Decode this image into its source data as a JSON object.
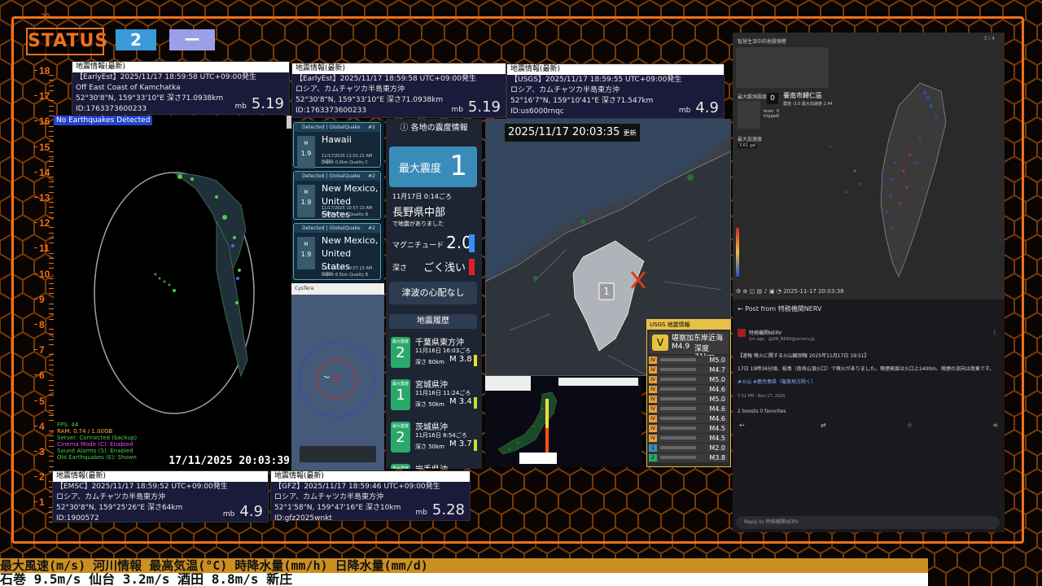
{
  "status": {
    "label": "STATUS",
    "level_a": "2",
    "level_b": "ー",
    "top_tick": "20"
  },
  "ruler_ticks": [
    "18",
    "17",
    "16",
    "15",
    "14",
    "13",
    "12",
    "11",
    "10",
    "9",
    "8",
    "7",
    "6",
    "5",
    "4",
    "3",
    "2",
    "1"
  ],
  "quakes": {
    "earlyest_1": {
      "header": "地震情報(最新)",
      "line1": "【EarlyEst】2025/11/17  18:59:58  UTC+09:00発生",
      "line2": "Off East Coast of Kamchatka",
      "line3": "52°30'8\"N, 159°33'10\"E  深さ71.0938km",
      "line4": "ID:1763373600233",
      "unit": "mb",
      "mag": "5.19"
    },
    "earlyest_2": {
      "header": "地震情報(最新)",
      "line1": "【EarlyEst】2025/11/17  18:59:58  UTC+09:00発生",
      "line2": "ロシア、カムチャツカ半島東方沖",
      "line3": "52°30'8\"N, 159°33'10\"E  深さ71.0938km",
      "line4": "ID:1763373600233",
      "unit": "mb",
      "mag": "5.19"
    },
    "usgs": {
      "header": "地震情報(最新)",
      "line1": "【USGS】2025/11/17  18:59:55  UTC+09:00発生",
      "line2": "ロシア、カムチャツカ半島東方沖",
      "line3": "52°16'7\"N, 159°10'41\"E  深さ71.547km",
      "line4": "ID:us6000rnqc",
      "unit": "mb",
      "mag": "4.9"
    },
    "emsc": {
      "header": "地震情報(最新)",
      "line1": "【EMSC】2025/11/17  18:59:52  UTC+09:00発生",
      "line2": "ロシア、カムチャツカ半島東方沖",
      "line3": "52°30'8\"N, 159°25'26\"E  深さ64km",
      "line4": "ID:1900572",
      "unit": "mb",
      "mag": "4.9"
    },
    "gfz": {
      "header": "地震情報(最新)",
      "line1": "【GFZ】2025/11/17  18:59:46  UTC+09:00発生",
      "line2": "ロシア、カムチャツカ半島東方沖",
      "line3": "52°1'58\"N, 159°47'16\"E  深さ10km",
      "line4": "ID:gfz2025wnkt",
      "unit": "mb",
      "mag": "5.28"
    }
  },
  "globe": {
    "banner": "No Earthquakes Detected",
    "sys": [
      "FPS: 44",
      "RAM: 0.74 / 1.00GB",
      "Server: Connected (backup)",
      "Cinema Mode (C): Enabled",
      "Sound Alarms (S): Enabled",
      "Old Earthquakes (E): Shown"
    ],
    "clock": "17/11/2025 20:03:39"
  },
  "gq": {
    "cards": [
      {
        "header": "Detected | GlobalQuake",
        "num": "#2",
        "m_label": "M",
        "m_val": "1.9",
        "title": "Hawaii",
        "sub1": "11/17/2025 11:01:21 AM (UTC)",
        "sub2": "Depth 0.0km    Quality C"
      },
      {
        "header": "Detected | GlobalQuake",
        "num": "#2",
        "m_label": "M",
        "m_val": "1.9",
        "title": "New Mexico, United States",
        "sub1": "11/17/2025 10:57:13 AM (UTC)",
        "sub2": "Depth 6.5km    Quality B"
      },
      {
        "header": "Detected | GlobalQuake",
        "num": "#2",
        "m_label": "M",
        "m_val": "1.9",
        "title": "New Mexico, United States",
        "sub1": "11/17/2025 10:57:13 AM (UTC)",
        "sub2": "Depth 6.5km    Quality B"
      }
    ]
  },
  "cystera": {
    "title": "CysTera"
  },
  "jp": {
    "header": "各地の震度情報",
    "max_label": "最大震度",
    "max_value": "1",
    "time": "11月17日  0:14ごろ",
    "place": "長野県中部",
    "note": "で地震がありました",
    "mag_label": "マグニチュード",
    "mag_value": "2.0",
    "depth_label": "深さ",
    "depth_value": "ごく浅い",
    "tsunami": "津波の心配なし",
    "history_title": "地震履歴",
    "history": [
      {
        "badge_top": "最大震度",
        "int": "2",
        "place": "千葉県東方沖",
        "time": "11月16日 16:03ごろ",
        "depth": "深さ  60km",
        "mag": "M 3.8",
        "bar": "#e8e020"
      },
      {
        "badge_top": "最大震度",
        "int": "1",
        "place": "宮城県沖",
        "time": "11月16日 11:24ごろ",
        "depth": "深さ  50km",
        "mag": "M 3.4",
        "bar": "#c8e020"
      },
      {
        "badge_top": "最大震度",
        "int": "2",
        "place": "茨城県沖",
        "time": "11月16日 8:54ごろ",
        "depth": "深さ  50km",
        "mag": "M 3.7",
        "bar": "#c8e020"
      },
      {
        "badge_top": "最大震度",
        "int": "",
        "place": "岩手県沖",
        "time": "",
        "depth": "",
        "mag": "",
        "bar": "#c8e020"
      }
    ]
  },
  "map": {
    "timestamp": "2025/11/17  20:03:35",
    "update": "更新",
    "region_int": "1"
  },
  "usgs_list": {
    "title": "USGS 地震情報",
    "headline": "堪察加东岸近海",
    "mag": "M4.9",
    "depth": "深度 71km",
    "int_top": "V",
    "items": [
      {
        "int": "IV",
        "mag": "M5.0"
      },
      {
        "int": "IV",
        "mag": "M4.7"
      },
      {
        "int": "IV",
        "mag": "M5.0"
      },
      {
        "int": "IV",
        "mag": "M4.6"
      },
      {
        "int": "IV",
        "mag": "M5.0"
      },
      {
        "int": "IV",
        "mag": "M4.6"
      },
      {
        "int": "IV",
        "mag": "M4.6"
      },
      {
        "int": "IV",
        "mag": "M4.5"
      },
      {
        "int": "IV",
        "mag": "M4.5"
      },
      {
        "int": "1",
        "mag": "M2.0"
      },
      {
        "int": "2",
        "mag": "M3.8"
      }
    ]
  },
  "tw": {
    "title": "智慧生活中的地震預警",
    "max_label": "最大觀測震度",
    "max_val": "0",
    "city": "臺南市歸仁區",
    "sub": "震度 -3.0    最大加速度 2.44",
    "level": "level",
    "trigger": "trigger",
    "lv_val": "0",
    "tr_val": "0",
    "accel_label": "最大加速度",
    "accel_val": "3.61 gal",
    "timestamp": "2025-11-17 20:03:38",
    "corner": "3 / 4"
  },
  "post": {
    "back": "Post from 特務機関NERV",
    "author": "特務機関NERV",
    "meta": "1m ago · @UN_NERV@unnerv.jp",
    "body1": "【速報 噴火に関する火山観測報 2025年11月17日 19:51】",
    "body2": "17日 19時36分頃、桜島（南岳山頂火口）で噴火がありました。噴煙高度は火口上1400m、噴煙の流向は南東です。",
    "tags": "#火山 #鹿児島県（奄美地方除く）",
    "time": "7:51 PM · Nov 17, 2025",
    "stats": "2 boosts  0 favorites",
    "reply": "Reply to 特務機関NERV"
  },
  "ticker": {
    "row1": "最大風速(m/s) 河川情報 最高気温(°C) 時降水量(mm/h) 日降水量(mm/d)",
    "row2": "  石巻 9.5m/s    仙台 3.2m/s    酒田 8.8m/s    新庄"
  },
  "colors": {
    "accent": "#f0701c",
    "frame_bg": "#000000",
    "mag_bar_blue": "#3a8cff",
    "mag_bar_red": "#e02020"
  }
}
